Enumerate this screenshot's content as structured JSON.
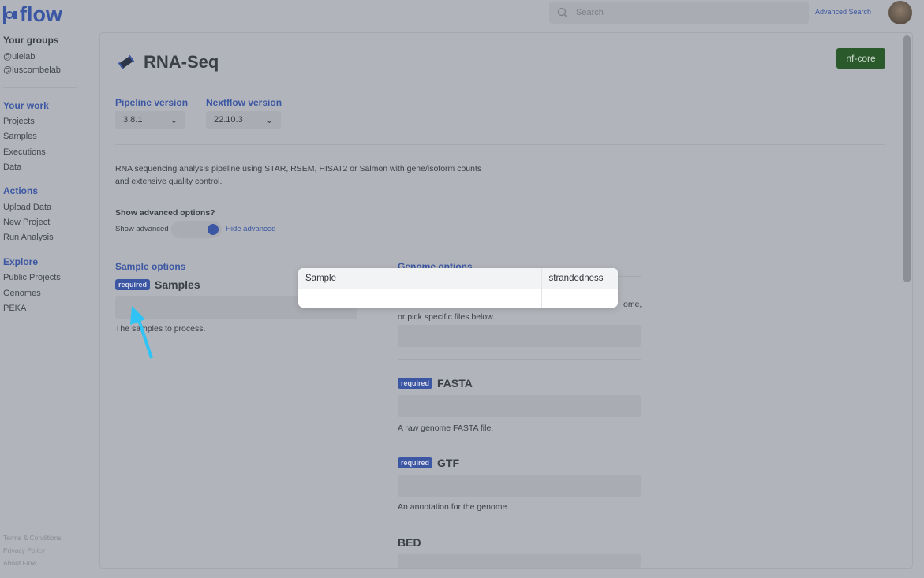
{
  "app": {
    "name": "flow"
  },
  "header": {
    "search_placeholder": "Search",
    "advanced_search": "Advanced Search"
  },
  "sidebar": {
    "groups_title": "Your groups",
    "groups": [
      "@ulelab",
      "@luscombelab"
    ],
    "sections": [
      {
        "title": "Your work",
        "items": [
          "Projects",
          "Samples",
          "Executions",
          "Data"
        ]
      },
      {
        "title": "Actions",
        "items": [
          "Upload Data",
          "New Project",
          "Run Analysis"
        ]
      },
      {
        "title": "Explore",
        "items": [
          "Public Projects",
          "Genomes",
          "PEKA"
        ]
      }
    ],
    "footer": [
      "Terms & Conditions",
      "Privacy Policy",
      "About Flow"
    ]
  },
  "pipeline": {
    "title": "RNA-Seq",
    "badge": "nf-core",
    "badge_color": "#2a5a2c",
    "pipeline_version_label": "Pipeline version",
    "pipeline_version": "3.8.1",
    "nextflow_version_label": "Nextflow version",
    "nextflow_version": "22.10.3",
    "description": "RNA sequencing analysis pipeline using STAR, RSEM, HISAT2 or Salmon with gene/isoform counts and extensive quality control.",
    "advanced_question": "Show advanced options?",
    "show_advanced": "Show advanced",
    "hide_advanced": "Hide advanced",
    "advanced_on": true
  },
  "sample_options": {
    "title": "Sample options",
    "required": "required",
    "field": "Samples",
    "hint": "The samples to process."
  },
  "genome_options": {
    "title": "Genome options",
    "hint_fragment": "ome,",
    "hint_line2": "or pick specific files below.",
    "fields": [
      {
        "required": "required",
        "name": "FASTA",
        "hint": "A raw genome FASTA file."
      },
      {
        "required": "required",
        "name": "GTF",
        "hint": "An annotation for the genome."
      },
      {
        "name": "BED"
      }
    ]
  },
  "popup": {
    "columns": [
      "Sample",
      "strandedness"
    ]
  }
}
